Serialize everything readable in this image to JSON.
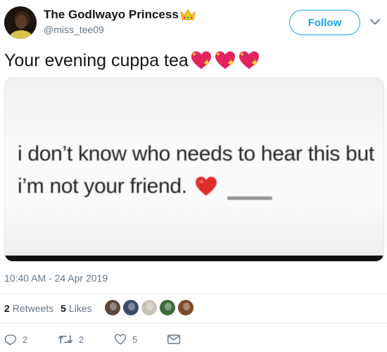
{
  "user": {
    "display_name": "The Godlwayo Princess",
    "handle": "@miss_tee09",
    "crown_icon": "crown-emoji-icon"
  },
  "header": {
    "follow_label": "Follow",
    "menu_icon": "chevron-down-icon"
  },
  "tweet": {
    "text": "Your evening cuppa tea",
    "emoji": [
      "sparkling-heart-icon",
      "sparkling-heart-icon",
      "sparkling-heart-icon"
    ],
    "image_text_line1": "i don’t know who needs to hear this but",
    "image_text_line2": "i’m not your friend.",
    "timestamp": "10:40 AM - 24 Apr 2019"
  },
  "stats": {
    "retweets_count": "2",
    "retweets_label": "Retweets",
    "likes_count": "5",
    "likes_label": "Likes",
    "liker_colors": [
      "#5b4a3c",
      "#3b4a66",
      "#c9c2b6",
      "#3f6a3a",
      "#7a4a2a"
    ]
  },
  "actions": {
    "reply_count": "2",
    "retweet_count": "2",
    "like_count": "5"
  },
  "colors": {
    "accent": "#1da1f2",
    "secondary_text": "#657786",
    "heart_red": "#e0245e"
  }
}
